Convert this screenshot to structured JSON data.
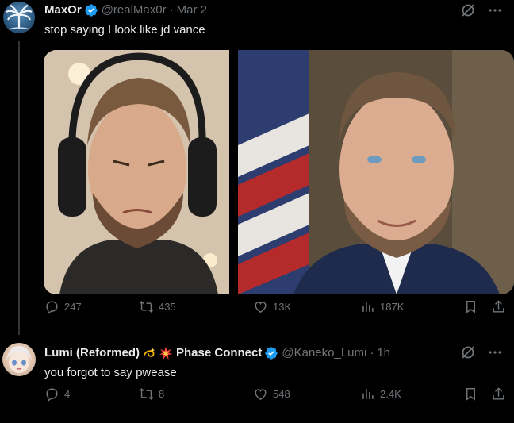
{
  "tweets": [
    {
      "display_name": "MaxOr",
      "handle": "@realMax0r",
      "separator": "·",
      "date": "Mar 2",
      "text": "stop saying I look like jd vance",
      "stats": {
        "replies": "247",
        "reposts": "435",
        "likes": "13K",
        "views": "187K"
      }
    },
    {
      "display_name": "Lumi (Reformed)",
      "display_name_suffix": "Phase Connect",
      "handle": "@Kaneko_Lumi",
      "separator": "·",
      "date": "1h",
      "text": "you forgot to say pwease",
      "stats": {
        "replies": "4",
        "reposts": "8",
        "likes": "548",
        "views": "2.4K"
      }
    }
  ],
  "colors": {
    "background": "#000000",
    "text": "#e7e9ea",
    "muted": "#71767b",
    "verified": "#1d9bf0",
    "thread": "#333639"
  },
  "icons": [
    "verified-badge-icon",
    "grok-icon",
    "more-icon",
    "reply-icon",
    "retweet-icon",
    "like-icon",
    "views-icon",
    "bookmark-icon",
    "share-icon",
    "dizzy-emoji-icon",
    "collision-emoji-icon"
  ]
}
